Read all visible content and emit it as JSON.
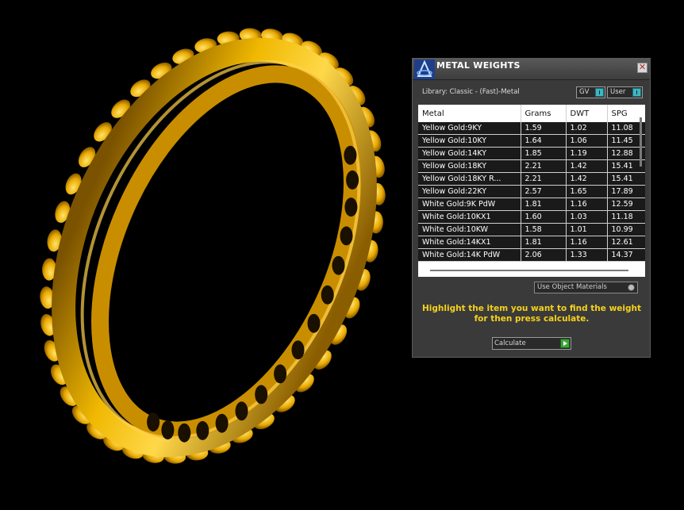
{
  "panel": {
    "title": "METAL WEIGHTS",
    "close_symbol": "✕",
    "library_label": "Library: Classic - (Fast)-Metal",
    "toggles": [
      {
        "label": "GV"
      },
      {
        "label": "User"
      }
    ],
    "columns": [
      "Metal",
      "Grams",
      "DWT",
      "SPG"
    ],
    "rows": [
      {
        "metal": "Yellow Gold:9KY",
        "grams": "1.59",
        "dwt": "1.02",
        "spg": "11.08"
      },
      {
        "metal": "Yellow Gold:10KY",
        "grams": "1.64",
        "dwt": "1.06",
        "spg": "11.45"
      },
      {
        "metal": "Yellow Gold:14KY",
        "grams": "1.85",
        "dwt": "1.19",
        "spg": "12.88"
      },
      {
        "metal": "Yellow Gold:18KY",
        "grams": "2.21",
        "dwt": "1.42",
        "spg": "15.41"
      },
      {
        "metal": "Yellow Gold:18KY R...",
        "grams": "2.21",
        "dwt": "1.42",
        "spg": "15.41"
      },
      {
        "metal": "Yellow Gold:22KY",
        "grams": "2.57",
        "dwt": "1.65",
        "spg": "17.89"
      },
      {
        "metal": "White Gold:9K PdW",
        "grams": "1.81",
        "dwt": "1.16",
        "spg": "12.59"
      },
      {
        "metal": "White Gold:10KX1",
        "grams": "1.60",
        "dwt": "1.03",
        "spg": "11.18"
      },
      {
        "metal": "White Gold:10KW",
        "grams": "1.58",
        "dwt": "1.01",
        "spg": "10.99"
      },
      {
        "metal": "White Gold:14KX1",
        "grams": "1.81",
        "dwt": "1.16",
        "spg": "12.61"
      },
      {
        "metal": "White Gold:14K PdW",
        "grams": "2.06",
        "dwt": "1.33",
        "spg": "14.37"
      }
    ],
    "use_object_materials_label": "Use Object Materials",
    "instruction": "Highlight the item you want to find the weight for then press calculate.",
    "calculate_label": "Calculate"
  },
  "icons": {
    "logo": "app-logo-icon",
    "close": "close-icon",
    "toggle_knob": "toggle-knob-icon",
    "radio": "radio-icon",
    "calculate_arrow": "play-arrow-icon"
  },
  "colors": {
    "background": "#000000",
    "panel": "#3a3a3a",
    "gold": "#f0b800",
    "instruction_text": "#f5d21c",
    "toggle_accent": "#3fb5c0",
    "calculate_accent": "#3fa33b"
  }
}
